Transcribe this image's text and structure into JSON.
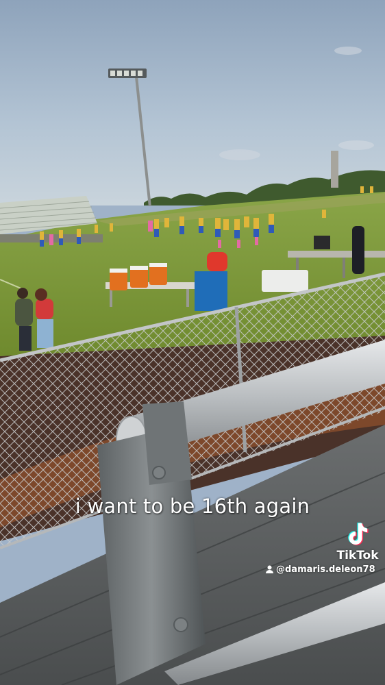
{
  "video": {
    "caption": "i want to be 16th again",
    "watermark": {
      "brand": "TikTok",
      "username": "@damaris.deleon78",
      "icon": "tiktok-note-icon"
    }
  },
  "colors": {
    "sky": "#a9bccf",
    "grass": "#7f9a3a",
    "track": "#5a3a2a",
    "jersey_gold": "#e0b53a",
    "cooler_orange": "#e2701f",
    "bin_blue": "#1f6db8"
  }
}
